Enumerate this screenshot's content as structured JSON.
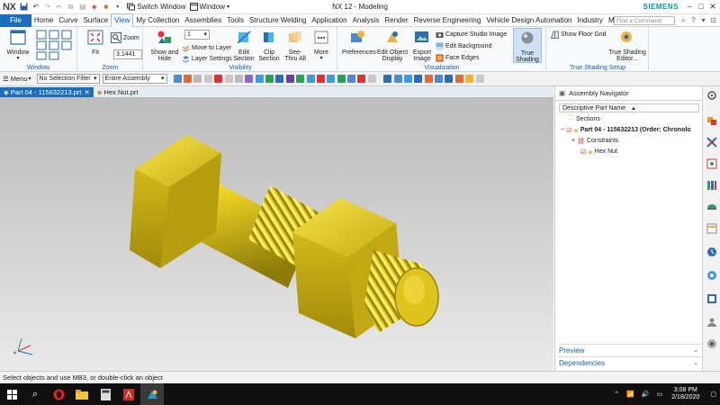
{
  "app": {
    "logo": "NX",
    "title": "NX 12 - Modeling",
    "brand": "SIEMENS",
    "switch_window": "Switch Window",
    "window_menu": "Window"
  },
  "menu": {
    "file": "File",
    "tabs": [
      "Home",
      "Curve",
      "Surface",
      "View",
      "My Collection",
      "Assemblies",
      "Tools",
      "Structure Welding",
      "Application",
      "Analysis",
      "Render",
      "Reverse Engineering",
      "Vehicle Design Automation",
      "Industry",
      "Mold Wizard"
    ],
    "active_tab": "View",
    "find_placeholder": "Find a Command"
  },
  "ribbon": {
    "window_group": {
      "label": "Window",
      "window_button": "Window"
    },
    "zoom_group": {
      "label": "Zoom",
      "fit": "Fit",
      "zoom": "Zoom",
      "zoom_value": "3.1441"
    },
    "visibility_group": {
      "label": "Visibility",
      "layer_value": "1",
      "show_and_hide": "Show and Hide",
      "move_to_layer": "Move to Layer",
      "layer_settings": "Layer Settings",
      "edit_section": "Edit Section",
      "clip_section": "Clip Section",
      "see_thru_all": "See-Thru All",
      "more": "More"
    },
    "visualization_group": {
      "label": "Visualization",
      "preferences": "Preferences",
      "edit_object_display": "Edit Object Display",
      "export_image": "Export Image",
      "capture_studio_image": "Capture Studio Image",
      "edit_background": "Edit Background",
      "face_edges": "Face Edges",
      "true_shading": "True Shading"
    },
    "true_shading_group": {
      "label": "True Shading Setup",
      "show_floor_grid": "Show Floor Grid",
      "true_shading_editor": "True Shading Editor..."
    }
  },
  "toolbar": {
    "menu": "Menu",
    "selection_filter": "No Selection Filter",
    "scope": "Entire Assembly"
  },
  "doc_tabs": [
    "Part 04 - 115632213.prt",
    "Hex Nut.prt"
  ],
  "navigator": {
    "title": "Assembly Navigator",
    "column": "Descriptive Part Name",
    "rows": [
      {
        "label": "Sections",
        "level": 0
      },
      {
        "label": "Part 04 - 115632213 (Order: Chronolo",
        "level": 0
      },
      {
        "label": "Constraints",
        "level": 1
      },
      {
        "label": "Hex Nut",
        "level": 1
      }
    ],
    "preview": "Preview",
    "dependencies": "Dependencies"
  },
  "status": "Select objects and use MB3, or double-click an object",
  "taskbar": {
    "time": "3:08 PM",
    "date": "2/18/2020"
  },
  "colors": {
    "accent": "#1c6dbb",
    "brand": "#009999",
    "gold": "#d8c21c"
  }
}
